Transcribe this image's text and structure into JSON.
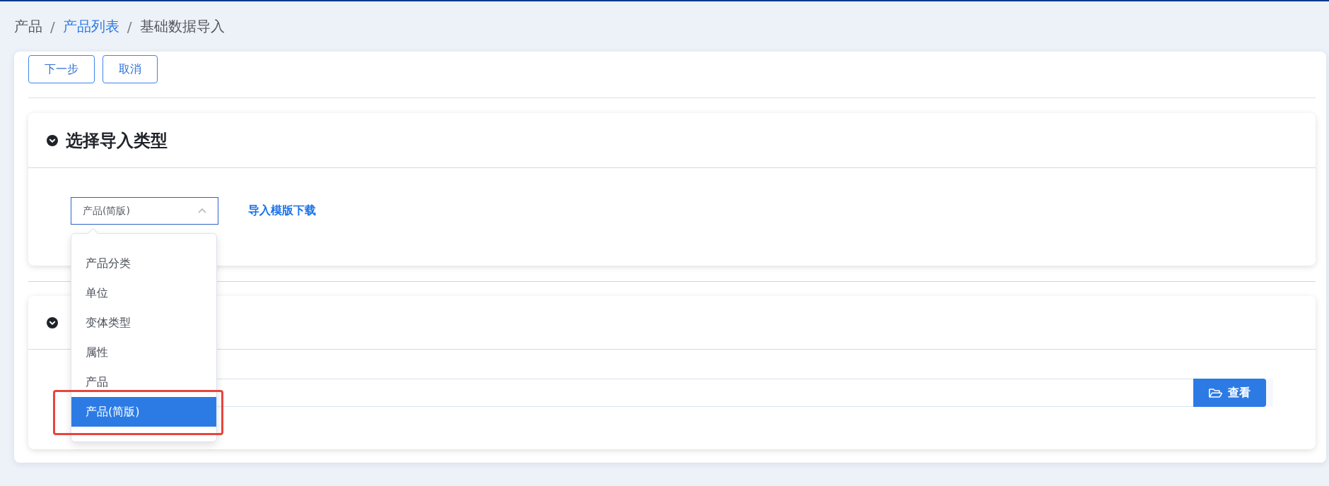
{
  "breadcrumb": [
    {
      "kind": "text",
      "label": "产品"
    },
    {
      "kind": "separator",
      "label": "/"
    },
    {
      "kind": "link",
      "label": "产品列表"
    },
    {
      "kind": "separator",
      "label": "/"
    },
    {
      "kind": "text",
      "label": "基础数据导入"
    }
  ],
  "toolbar": {
    "buttons": [
      {
        "label": "下一步"
      },
      {
        "label": "取消"
      }
    ]
  },
  "sections": [
    {
      "kind": "type-select",
      "title": "选择导入类型",
      "expanded": true,
      "select": {
        "value": "产品(简版)",
        "open": true,
        "options": [
          {
            "label": "产品分类",
            "selected": false,
            "annotated": false
          },
          {
            "label": "单位",
            "selected": false,
            "annotated": false
          },
          {
            "label": "变体类型",
            "selected": false,
            "annotated": false
          },
          {
            "label": "属性",
            "selected": false,
            "annotated": false
          },
          {
            "label": "产品",
            "selected": false,
            "annotated": false
          },
          {
            "label": "产品(简版)",
            "selected": true,
            "annotated": true
          }
        ]
      },
      "link": "导入模版下载"
    },
    {
      "kind": "file-upload",
      "expanded": true,
      "file": {
        "button": "查看"
      }
    }
  ]
}
